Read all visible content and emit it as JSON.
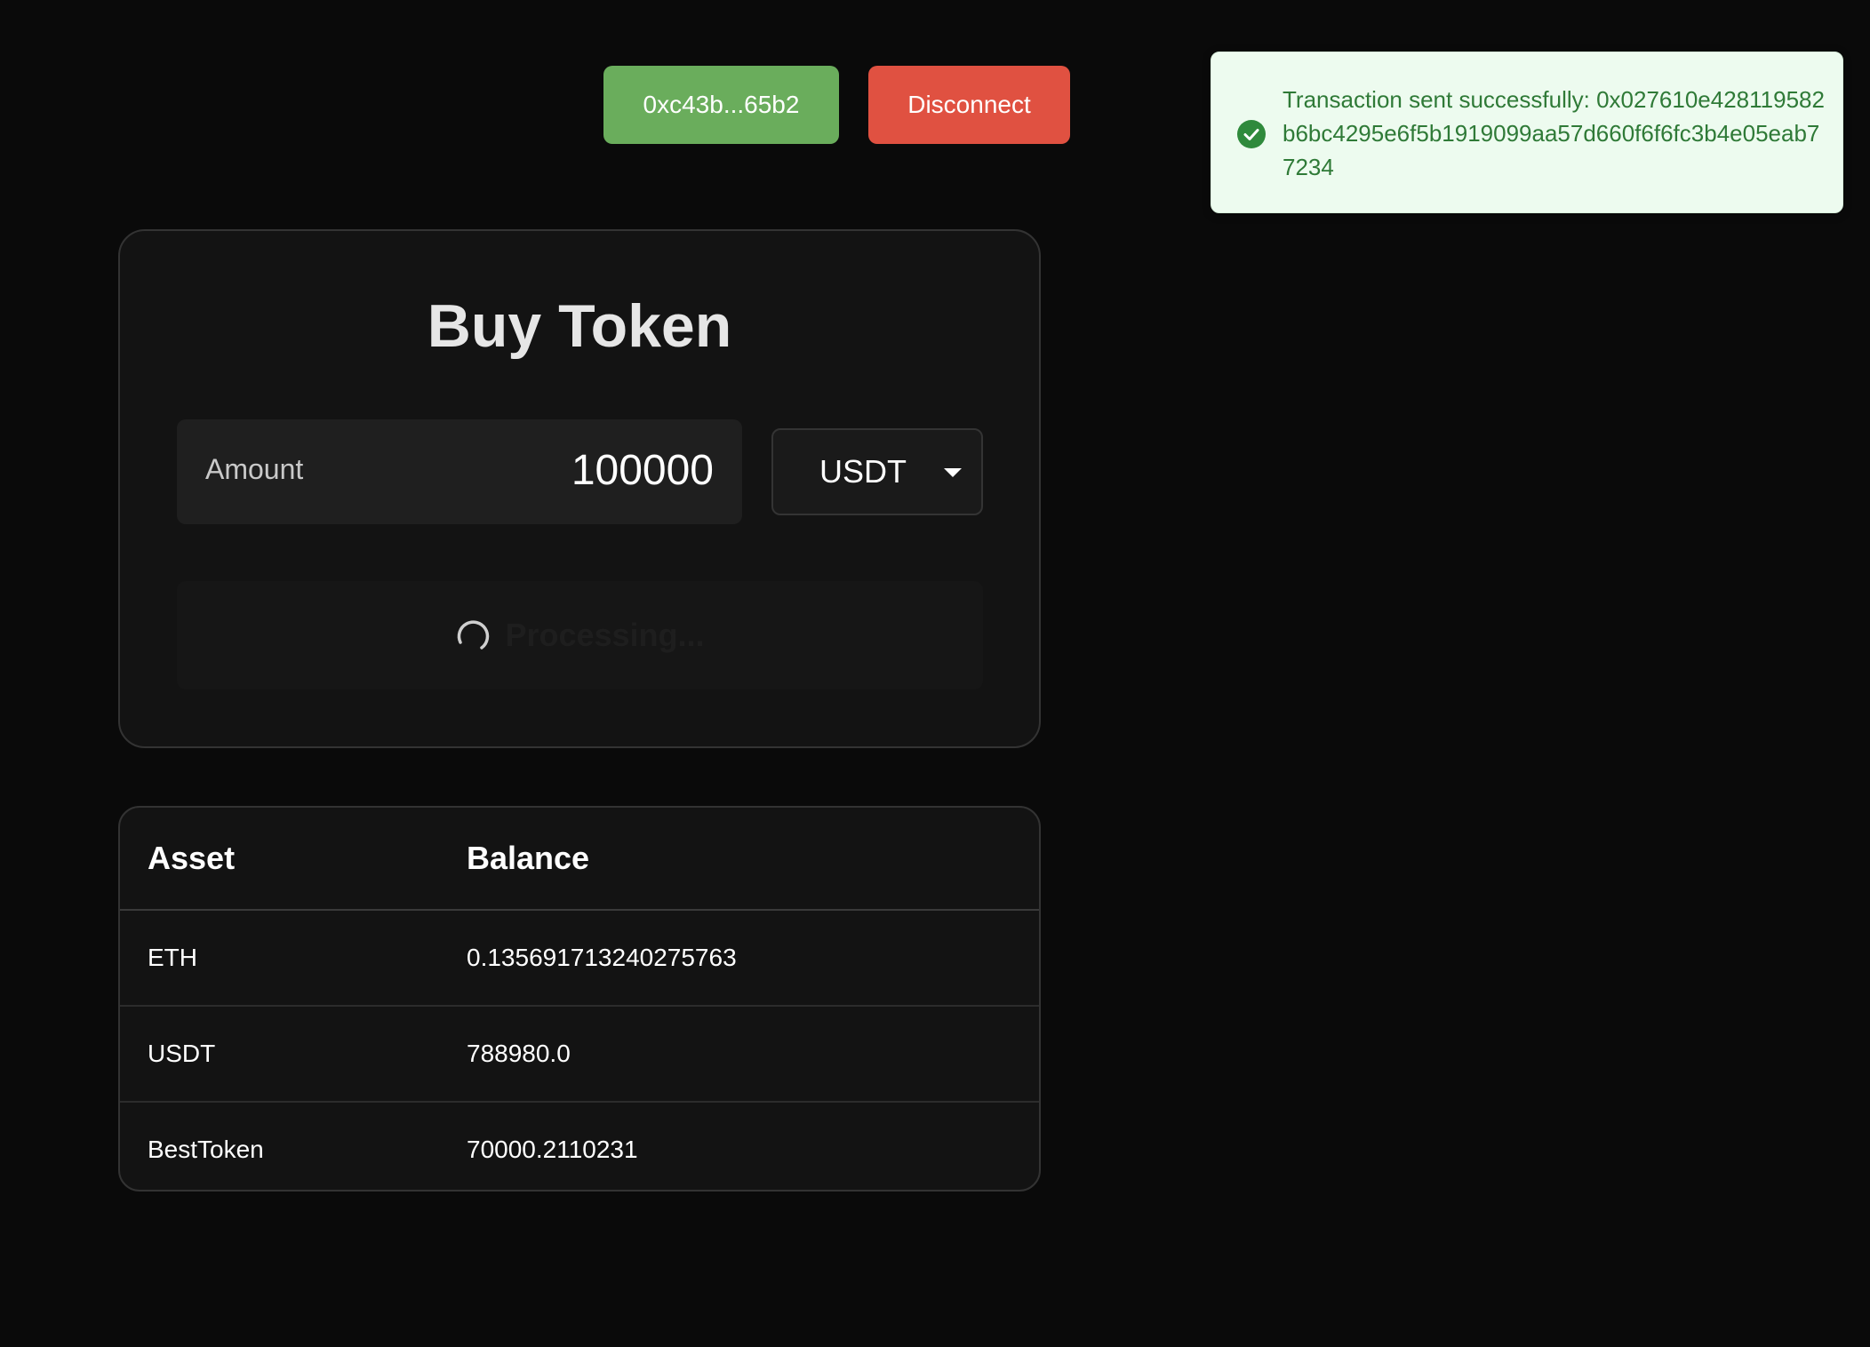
{
  "header": {
    "address_label": "0xc43b...65b2",
    "disconnect_label": "Disconnect"
  },
  "toast": {
    "message": "Transaction sent successfully: 0x027610e428119582b6bc4295e6f5b1919099aa57d660f6f6fc3b4e05eab77234",
    "icon": "check-circle-icon",
    "color": "#2f7a37"
  },
  "buy": {
    "title": "Buy Token",
    "amount_label": "Amount",
    "amount_value": "100000",
    "token_selected": "USDT",
    "process_label": "Processing..."
  },
  "balances": {
    "headers": {
      "asset": "Asset",
      "balance": "Balance"
    },
    "rows": [
      {
        "asset": "ETH",
        "balance": "0.135691713240275763"
      },
      {
        "asset": "USDT",
        "balance": "788980.0"
      },
      {
        "asset": "BestToken",
        "balance": "70000.2110231"
      }
    ]
  },
  "colors": {
    "background": "#0a0a0a",
    "address_button": "#6aad5c",
    "disconnect_button": "#e05141",
    "toast_background": "#edfbef"
  }
}
